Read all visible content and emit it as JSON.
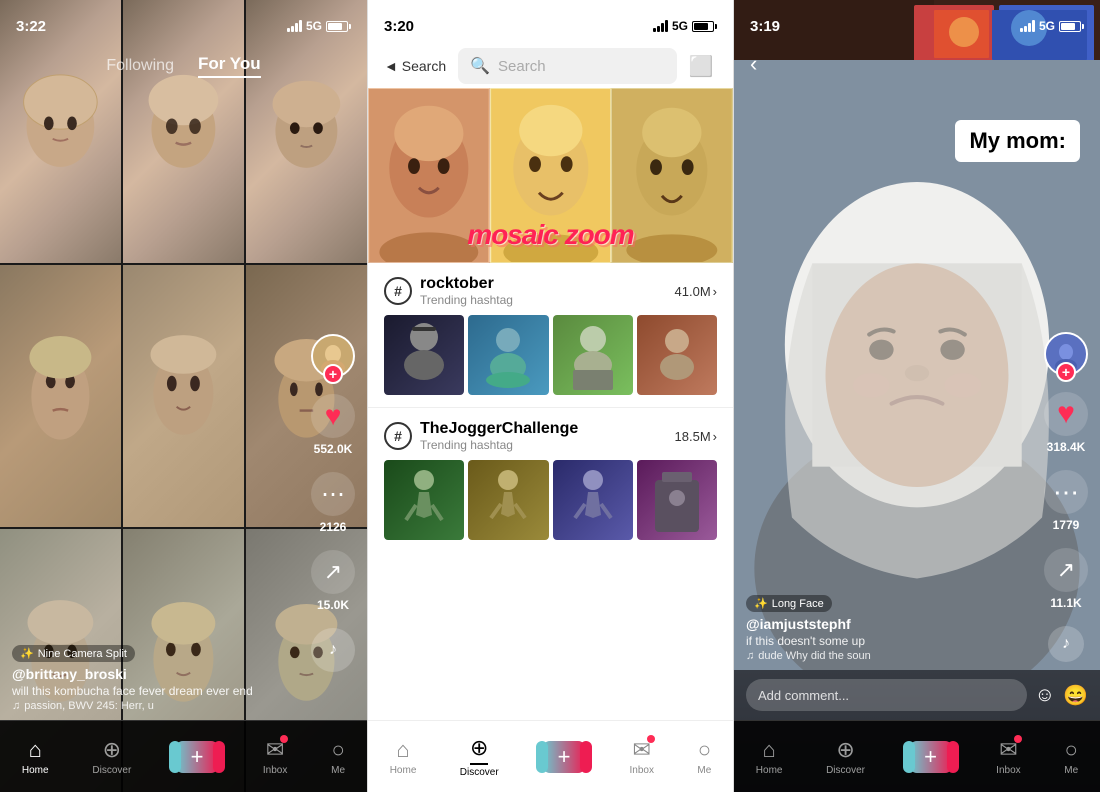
{
  "panel1": {
    "status": {
      "time": "3:22",
      "signal": "5G",
      "battery": 80
    },
    "nav": {
      "following": "Following",
      "forYou": "For You",
      "active": "forYou"
    },
    "actions": {
      "likes": "552.0K",
      "comments": "2126",
      "shares": "15.0K"
    },
    "info": {
      "effect": "Nine Camera Split",
      "username": "@brittany_broski",
      "caption": "will this kombucha face fever dream ever end",
      "music": "passion, BWV 245: Herr, u"
    },
    "bottomNav": {
      "home": "Home",
      "discover": "Discover",
      "inbox": "Inbox",
      "me": "Me"
    }
  },
  "panel2": {
    "status": {
      "time": "3:20",
      "signal": "5G",
      "battery": 80
    },
    "search": {
      "back": "◄ Search",
      "placeholder": "Search",
      "placeholder_display": "Search"
    },
    "mosaic": {
      "text": "mosaic zoom"
    },
    "trending": [
      {
        "tag": "rocktober",
        "label": "Trending hashtag",
        "count": "41.0M"
      },
      {
        "tag": "TheJoggerChallenge",
        "label": "Trending hashtag",
        "count": "18.5M"
      }
    ],
    "bottomNav": {
      "home": "Home",
      "discover": "Discover",
      "inbox": "Inbox",
      "me": "Me"
    }
  },
  "panel3": {
    "status": {
      "time": "3:19",
      "signal": "5G",
      "battery": 75
    },
    "callout": "My mom:",
    "actions": {
      "likes": "318.4K",
      "comments": "1779",
      "shares": "11.1K"
    },
    "info": {
      "effect": "Long Face",
      "username": "@iamjuststephf",
      "caption": "if this doesn't some up",
      "music": "dude  Why did the soun"
    },
    "comment": {
      "placeholder": "Add comment..."
    },
    "bottomNav": {
      "home": "Home",
      "discover": "Discover",
      "inbox": "Inbox",
      "me": "Me"
    }
  }
}
